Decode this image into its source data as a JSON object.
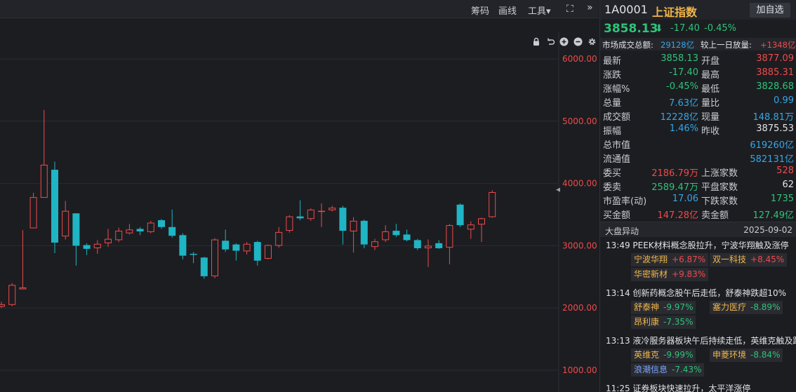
{
  "toolbar": {
    "chips_label": "筹码",
    "draw_label": "画线",
    "tools_label": "工具▾",
    "fullscreen_glyph": "⛶",
    "collapse_glyph": "»"
  },
  "chart_data": {
    "type": "candlestick",
    "title": "",
    "ylim": [
      800,
      6500
    ],
    "y_ticks": [
      6000,
      5000,
      4000,
      3000,
      2000,
      1000
    ],
    "y_tick_labels": [
      "6000.00",
      "5000.00",
      "4000.00",
      "3000.00",
      "2000.00",
      "1000.00"
    ],
    "current_price_marker": 4000,
    "grid": true,
    "candles": [
      {
        "o": 2020,
        "c": 2060,
        "h": 2100,
        "l": 2000
      },
      {
        "o": 2050,
        "c": 2370,
        "h": 2400,
        "l": 2030
      },
      {
        "o": 2300,
        "c": 2330,
        "h": 3250,
        "l": 2300
      },
      {
        "o": 3280,
        "c": 3780,
        "h": 3850,
        "l": 3280
      },
      {
        "o": 3770,
        "c": 4300,
        "h": 5180,
        "l": 3770
      },
      {
        "o": 4220,
        "c": 3050,
        "h": 4350,
        "l": 2880
      },
      {
        "o": 3150,
        "c": 3560,
        "h": 3720,
        "l": 3100
      },
      {
        "o": 3520,
        "c": 3000,
        "h": 3520,
        "l": 2680
      },
      {
        "o": 3010,
        "c": 2950,
        "h": 3040,
        "l": 2850
      },
      {
        "o": 2960,
        "c": 3030,
        "h": 3090,
        "l": 2870
      },
      {
        "o": 3040,
        "c": 3110,
        "h": 3270,
        "l": 2980
      },
      {
        "o": 3090,
        "c": 3240,
        "h": 3290,
        "l": 3060
      },
      {
        "o": 3200,
        "c": 3260,
        "h": 3350,
        "l": 3180
      },
      {
        "o": 3270,
        "c": 3230,
        "h": 3300,
        "l": 3170
      },
      {
        "o": 3220,
        "c": 3370,
        "h": 3400,
        "l": 3200
      },
      {
        "o": 3410,
        "c": 3300,
        "h": 3430,
        "l": 3270
      },
      {
        "o": 3300,
        "c": 3160,
        "h": 3580,
        "l": 3130
      },
      {
        "o": 3170,
        "c": 2840,
        "h": 3200,
        "l": 2780
      },
      {
        "o": 2870,
        "c": 2860,
        "h": 2900,
        "l": 2720
      },
      {
        "o": 2810,
        "c": 2510,
        "h": 2820,
        "l": 2470
      },
      {
        "o": 2510,
        "c": 3100,
        "h": 3120,
        "l": 2480
      },
      {
        "o": 3080,
        "c": 2940,
        "h": 3260,
        "l": 2900
      },
      {
        "o": 3020,
        "c": 2920,
        "h": 3040,
        "l": 2760
      },
      {
        "o": 2910,
        "c": 3030,
        "h": 3060,
        "l": 2860
      },
      {
        "o": 3060,
        "c": 2760,
        "h": 3080,
        "l": 2680
      },
      {
        "o": 2790,
        "c": 3010,
        "h": 3020,
        "l": 2780
      },
      {
        "o": 3000,
        "c": 3220,
        "h": 3300,
        "l": 2970
      },
      {
        "o": 3240,
        "c": 3470,
        "h": 3490,
        "l": 3210
      },
      {
        "o": 3470,
        "c": 3440,
        "h": 3730,
        "l": 3410
      },
      {
        "o": 3430,
        "c": 3580,
        "h": 3600,
        "l": 3400
      },
      {
        "o": 3550,
        "c": 3560,
        "h": 3680,
        "l": 3300
      },
      {
        "o": 3570,
        "c": 3610,
        "h": 3640,
        "l": 3550
      },
      {
        "o": 3610,
        "c": 3240,
        "h": 3640,
        "l": 3020
      },
      {
        "o": 3230,
        "c": 3400,
        "h": 3460,
        "l": 2890
      },
      {
        "o": 3400,
        "c": 3020,
        "h": 3420,
        "l": 2960
      },
      {
        "o": 2980,
        "c": 3070,
        "h": 3110,
        "l": 2930
      },
      {
        "o": 3090,
        "c": 3230,
        "h": 3330,
        "l": 3060
      },
      {
        "o": 3240,
        "c": 3170,
        "h": 3350,
        "l": 3140
      },
      {
        "o": 3180,
        "c": 3090,
        "h": 3260,
        "l": 3070
      },
      {
        "o": 3090,
        "c": 2960,
        "h": 3110,
        "l": 2930
      },
      {
        "o": 2960,
        "c": 3000,
        "h": 3100,
        "l": 2660
      },
      {
        "o": 3040,
        "c": 2960,
        "h": 3090,
        "l": 2950
      },
      {
        "o": 2970,
        "c": 3330,
        "h": 3350,
        "l": 2700
      },
      {
        "o": 3660,
        "c": 3330,
        "h": 3680,
        "l": 3300
      },
      {
        "o": 3260,
        "c": 3340,
        "h": 3390,
        "l": 3110
      },
      {
        "o": 3340,
        "c": 3440,
        "h": 3450,
        "l": 3060
      },
      {
        "o": 3460,
        "c": 3860,
        "h": 3890,
        "l": 3450
      }
    ]
  },
  "quote": {
    "code": "1A0001",
    "name": "上证指数",
    "watch_label": "加自选",
    "last": "3858.13",
    "arrow": "⬇",
    "change": "-17.40",
    "change_pct": "-0.45%",
    "turnover_label": "市场成交总额:",
    "turnover_value": "29128亿",
    "vs_prev_label": "较上一日放量:",
    "vs_prev_value": "+1348亿",
    "stats": [
      {
        "l1": "最新",
        "v1": "3858.13",
        "c1": "green",
        "l2": "开盘",
        "v2": "3877.09",
        "c2": "red"
      },
      {
        "l1": "涨跌",
        "v1": "-17.40",
        "c1": "green",
        "l2": "最高",
        "v2": "3885.31",
        "c2": "red"
      },
      {
        "l1": "涨幅%",
        "v1": "-0.45%",
        "c1": "green",
        "l2": "最低",
        "v2": "3828.68",
        "c2": "green"
      },
      {
        "l1": "总量",
        "v1": "7.63亿",
        "c1": "blue",
        "l2": "量比",
        "v2": "0.99",
        "c2": "blue"
      },
      {
        "l1": "成交额",
        "v1": "12228亿",
        "c1": "blue",
        "l2": "现量",
        "v2": "148.81万",
        "c2": "blue"
      },
      {
        "l1": "振幅",
        "v1": "1.46%",
        "c1": "blue",
        "l2": "昨收",
        "v2": "3875.53",
        "c2": "white"
      },
      {
        "l1": "总市值",
        "v1": "",
        "c1": "blue",
        "l2": "",
        "v2": "619260亿",
        "c2": "blue"
      },
      {
        "l1": "流通值",
        "v1": "",
        "c1": "blue",
        "l2": "",
        "v2": "582131亿",
        "c2": "blue"
      },
      {
        "l1": "委买",
        "v1": "2186.79万",
        "c1": "red",
        "l2": "上涨家数",
        "v2": "528",
        "c2": "red"
      },
      {
        "l1": "委卖",
        "v1": "2589.47万",
        "c1": "green",
        "l2": "平盘家数",
        "v2": "62",
        "c2": "white"
      },
      {
        "l1": "市盈率(动)",
        "v1": "17.06",
        "c1": "blue",
        "l2": "下跌家数",
        "v2": "1735",
        "c2": "green"
      },
      {
        "l1": "买金额",
        "v1": "147.28亿",
        "c1": "red",
        "l2": "卖金额",
        "v2": "127.49亿",
        "c2": "green"
      }
    ]
  },
  "news": {
    "title": "大盘异动",
    "date": "2025-09-02",
    "items": [
      {
        "text": "13:49 PEEK材料概念股拉升，宁波华翔触及涨停",
        "tags": [
          {
            "name": "宁波华翔",
            "pct": "+6.87%",
            "dir": "up",
            "name_color": "orange"
          },
          {
            "name": "双一科技",
            "pct": "+8.45%",
            "dir": "up",
            "name_color": "orange"
          },
          {
            "name": "华密新材",
            "pct": "+9.83%",
            "dir": "up",
            "name_color": "orange"
          }
        ]
      },
      {
        "text": "13:14 创新药概念股午后走低，舒泰神跌超10%",
        "tags": [
          {
            "name": "舒泰神",
            "pct": "-9.97%",
            "dir": "down",
            "name_color": "orange"
          },
          {
            "name": "塞力医疗",
            "pct": "-8.89%",
            "dir": "down",
            "name_color": "orange"
          },
          {
            "name": "昂利康",
            "pct": "-7.35%",
            "dir": "down",
            "name_color": "orange"
          }
        ]
      },
      {
        "text": "13:13 液冷服务器板块午后持续走低，英维克触及跌",
        "tags": [
          {
            "name": "英维克",
            "pct": "-9.99%",
            "dir": "down",
            "name_color": "orange"
          },
          {
            "name": "申菱环境",
            "pct": "-8.84%",
            "dir": "down",
            "name_color": "orange"
          },
          {
            "name": "浪潮信息",
            "pct": "-7.43%",
            "dir": "down",
            "name_color": "blue"
          }
        ]
      },
      {
        "text": "11:25 证券板块快速拉升，太平洋涨停",
        "tags": []
      }
    ]
  }
}
